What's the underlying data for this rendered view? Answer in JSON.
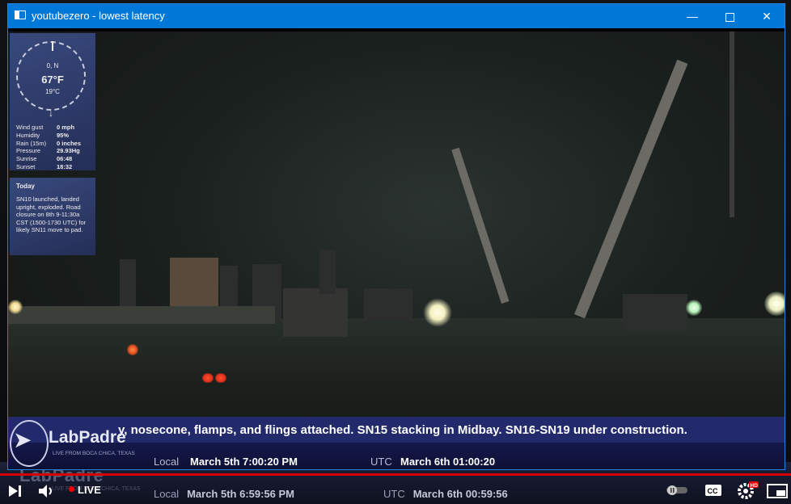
{
  "window": {
    "title": "youtubezero - lowest latency"
  },
  "weather": {
    "wind_dir": "0, N",
    "temp_f": "67°F",
    "temp_c": "19°C",
    "rows": [
      {
        "k": "Wind gust",
        "v": "0 mph"
      },
      {
        "k": "Humidity",
        "v": "95%"
      },
      {
        "k": "Rain (15m)",
        "v": "0 inches"
      },
      {
        "k": "Pressure",
        "v": "29.93Hg"
      },
      {
        "k": "Sunrise",
        "v": "06:48"
      },
      {
        "k": "Sunset",
        "v": "18:32"
      }
    ]
  },
  "today": {
    "heading": "Today",
    "text": "SN10 launched, landed upright, exploded. Road closure on 8th 9-11:30a CST (1500-1730 UTC) for likely SN11 move to pad."
  },
  "ticker": {
    "text": "y, nosecone, flamps, and flings attached. SN15 stacking in Midbay. SN16-SN19 under construction.",
    "brand": "LabPadre",
    "brand_sub": "LIVE FROM BOCA CHICA, TEXAS",
    "local_label": "Local",
    "local_time": "March 5th  7:00:20  PM",
    "utc_label": "UTC",
    "utc_time": "March 6th  01:00:20"
  },
  "background_stream": {
    "brand": "LabPadre",
    "brand_sub": "LIVE FROM BOCA CHICA, TEXAS",
    "local_label": "Local",
    "local_time": "March 5th  6:59:56  PM",
    "utc_label": "UTC",
    "utc_time": "March 6th  00:59:56",
    "live_label": "LIVE"
  },
  "colors": {
    "titlebar": "#0078d7",
    "youtube_red": "#d40000",
    "ticker_blue": "#232a6c"
  }
}
